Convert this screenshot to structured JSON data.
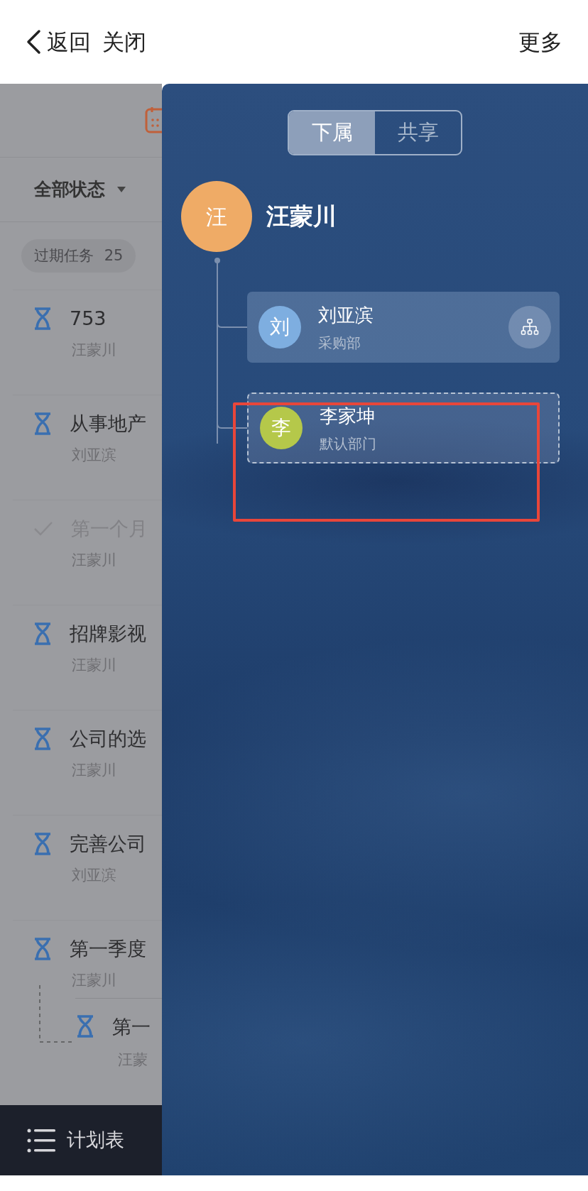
{
  "header": {
    "back": "返回",
    "close": "关闭",
    "more": "更多"
  },
  "filter": {
    "label": "全部状态"
  },
  "chip": {
    "label": "过期任务",
    "count": "25"
  },
  "tasks": [
    {
      "title": "753",
      "owner": "汪蒙川",
      "done": false
    },
    {
      "title": "从事地产",
      "owner": "刘亚滨",
      "done": false
    },
    {
      "title": "第一个月",
      "owner": "汪蒙川",
      "done": true
    },
    {
      "title": "招牌影视",
      "owner": "汪蒙川",
      "done": false
    },
    {
      "title": "公司的选",
      "owner": "汪蒙川",
      "done": false
    },
    {
      "title": "完善公司",
      "owner": "刘亚滨",
      "done": false
    },
    {
      "title": "第一季度",
      "owner": "汪蒙川",
      "done": false,
      "children": [
        {
          "title": "第一",
          "owner": "汪蒙",
          "done": false
        }
      ]
    }
  ],
  "bottom_bar": {
    "label": "计划表"
  },
  "drawer": {
    "tabs": [
      {
        "label": "下属",
        "selected": true
      },
      {
        "label": "共享",
        "selected": false
      }
    ],
    "root": {
      "avatar": "汪",
      "name": "汪蒙川",
      "color": "#efab66"
    },
    "members": [
      {
        "avatar": "刘",
        "name": "刘亚滨",
        "dept": "采购部",
        "color": "#7eaee0",
        "kind": "solid",
        "has_subordinates": true
      },
      {
        "avatar": "李",
        "name": "李家坤",
        "dept": "默认部门",
        "color": "#b5c84a",
        "kind": "dashed",
        "has_subordinates": false
      }
    ]
  }
}
